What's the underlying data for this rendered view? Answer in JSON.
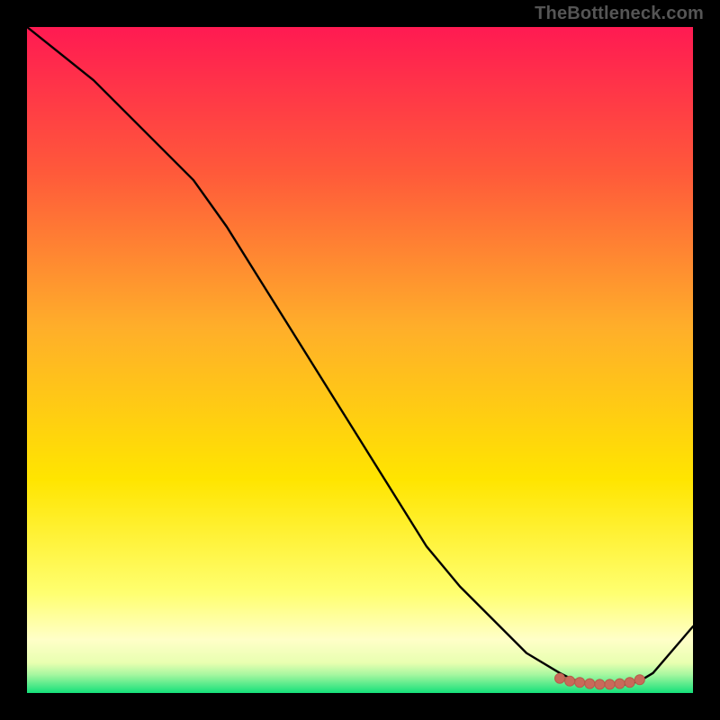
{
  "watermark": "TheBottleneck.com",
  "colors": {
    "background": "#000000",
    "gradient_top": "#ff1a52",
    "gradient_mid_upper": "#ff8a2a",
    "gradient_mid": "#ffe500",
    "gradient_lower": "#ffff9a",
    "gradient_band": "#f1ffb0",
    "gradient_bottom": "#14e07a",
    "curve": "#000000",
    "marker_stroke": "#b85a4a",
    "marker_fill": "#c86a5a"
  },
  "chart_data": {
    "type": "line",
    "title": "",
    "xlabel": "",
    "ylabel": "",
    "xlim": [
      0,
      100
    ],
    "ylim": [
      0,
      100
    ],
    "series": [
      {
        "name": "curve",
        "x": [
          0,
          5,
          10,
          15,
          20,
          25,
          30,
          35,
          40,
          45,
          50,
          55,
          60,
          65,
          70,
          75,
          80,
          82,
          84,
          86,
          88,
          90,
          92,
          94,
          100
        ],
        "y": [
          100,
          96,
          92,
          87,
          82,
          77,
          70,
          62,
          54,
          46,
          38,
          30,
          22,
          16,
          11,
          6,
          3,
          2,
          1.5,
          1.3,
          1.2,
          1.3,
          1.8,
          3,
          10
        ]
      }
    ],
    "markers": {
      "name": "highlight",
      "x": [
        80,
        81.5,
        83,
        84.5,
        86,
        87.5,
        89,
        90.5,
        92
      ],
      "y": [
        2.2,
        1.8,
        1.6,
        1.4,
        1.3,
        1.3,
        1.4,
        1.6,
        2.0
      ]
    }
  }
}
